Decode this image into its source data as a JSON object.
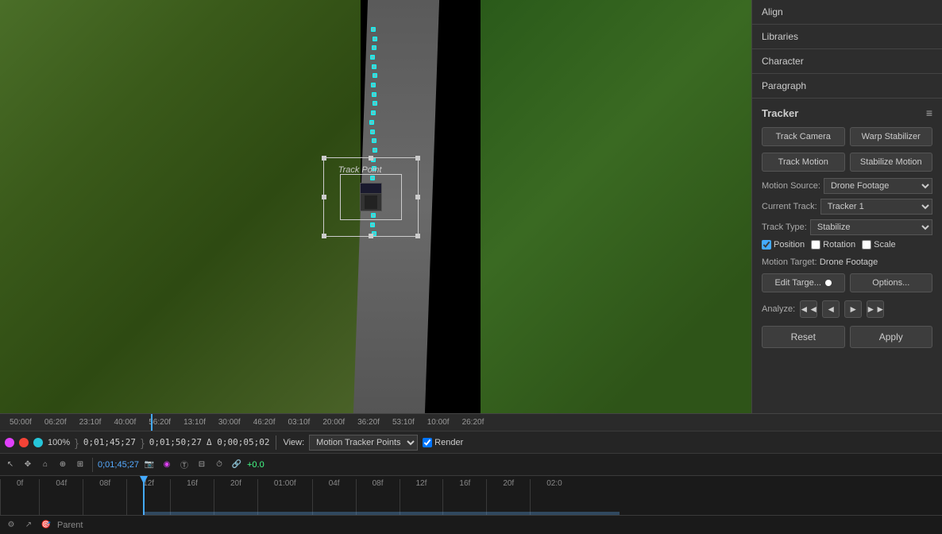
{
  "panel": {
    "sections": [
      {
        "id": "align",
        "label": "Align"
      },
      {
        "id": "libraries",
        "label": "Libraries"
      },
      {
        "id": "character",
        "label": "Character"
      },
      {
        "id": "paragraph",
        "label": "Paragraph"
      }
    ],
    "tracker": {
      "title": "Tracker",
      "buttons": {
        "track_camera": "Track Camera",
        "warp_stabilizer": "Warp Stabilizer",
        "track_motion": "Track Motion",
        "stabilize_motion": "Stabilize Motion"
      },
      "motion_source_label": "Motion Source:",
      "motion_source_value": "Drone Footage",
      "current_track_label": "Current Track:",
      "current_track_value": "Tracker 1",
      "track_type_label": "Track Type:",
      "track_type_value": "Stabilize",
      "checkboxes": {
        "position": "Position",
        "rotation": "Rotation",
        "scale": "Scale"
      },
      "motion_target_label": "Motion Target:",
      "motion_target_value": "Drone Footage",
      "edit_target_btn": "Edit Targe...",
      "options_btn": "Options...",
      "analyze_label": "Analyze:",
      "analyze_buttons": [
        "◄◄",
        "◄",
        "►",
        "►►"
      ],
      "reset_btn": "Reset",
      "apply_btn": "Apply"
    }
  },
  "controls": {
    "zoom": "100%",
    "time1": "0;01;45;27",
    "time2": "0;01;50;27",
    "delta": "Δ 0;00;05;02",
    "view_label": "View:",
    "view_option": "Motion Tracker Points",
    "render_label": "Render"
  },
  "timeline": {
    "markers": [
      "50:00f",
      "06:20f",
      "23:10f",
      "40:00f",
      "56:20f",
      "13:10f",
      "30:00f",
      "46:20f",
      "03:10f",
      "20:00f",
      "36:20f",
      "53:10f",
      "10:00f",
      "26:20f"
    ],
    "current_time": "0;01;45;27",
    "bottom_markers": [
      "0f",
      "04f",
      "08f",
      "12f",
      "16f",
      "20f",
      "01:00f",
      "04f",
      "08f",
      "12f",
      "16f",
      "20f",
      "02:0"
    ]
  },
  "bottom": {
    "parent_label": "Parent"
  },
  "track_point_label": "Track Point"
}
